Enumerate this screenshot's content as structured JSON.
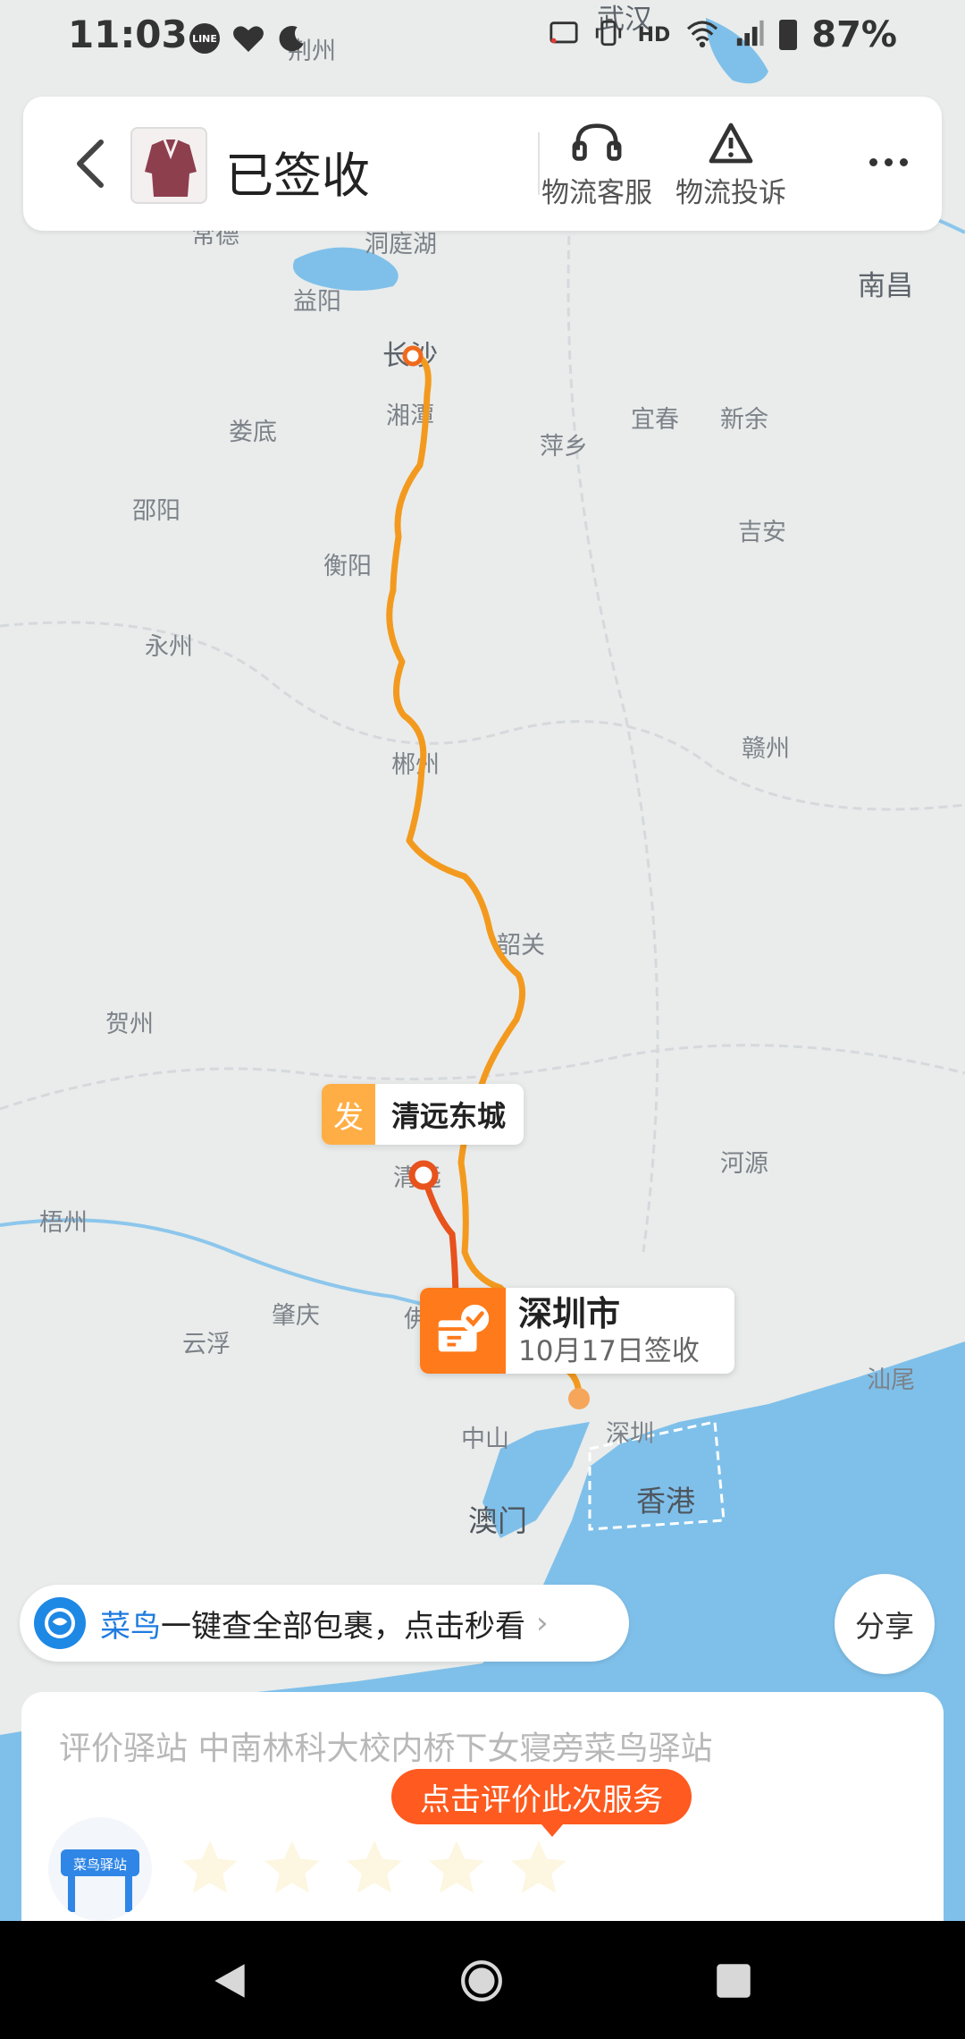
{
  "status_bar": {
    "time": "11:03",
    "battery": "87%",
    "icons": [
      "line-icon",
      "heart-icon",
      "moon-icon",
      "cast-icon",
      "vibrate-icon",
      "hd-icon",
      "wifi-icon",
      "signal-icon",
      "battery-icon"
    ]
  },
  "header": {
    "title": "已签收",
    "customer_service_label": "物流客服",
    "complaint_label": "物流投诉"
  },
  "map": {
    "labels": {
      "wuhan": "武汉",
      "jingzhou": "荆州",
      "dongting": "洞庭湖",
      "changde": "常德",
      "yiyang": "益阳",
      "changsha": "长沙",
      "xiangtan": "湘潭",
      "loudi": "娄底",
      "pingxiang": "萍乡",
      "yichun": "宜春",
      "xinyu": "新余",
      "nanchang": "南昌",
      "shaoyang": "邵阳",
      "hengyang": "衡阳",
      "jian": "吉安",
      "yongzhou": "永州",
      "chenzhou": "郴州",
      "ganzhou": "赣州",
      "shaoguan": "韶关",
      "hezhou": "贺州",
      "qingyuan": "清远",
      "heyuan": "河源",
      "wuzhou": "梧州",
      "zhaoqing": "肇庆",
      "yunfu": "云浮",
      "foshan": "佛",
      "zhongshan": "中山",
      "shenzhen": "深圳",
      "shanwei": "汕尾",
      "macau": "澳门",
      "hongkong": "香港"
    },
    "origin_badge": "发",
    "origin_name": "清远东城",
    "destination_city": "深圳市",
    "destination_status": "10月17日签收"
  },
  "banner": {
    "brand": "菜鸟",
    "text": "一键查全部包裹，点击秒看"
  },
  "share_label": "分享",
  "review": {
    "station_line": "评价驿站 中南林科大校内桥下女寝旁菜鸟驿站",
    "tip": "点击评价此次服务",
    "station_logo_text": "菜鸟驿站",
    "rating": 0,
    "max_rating": 5
  },
  "colors": {
    "route": "#f39a1e",
    "route_dark": "#e8521c",
    "accent_orange": "#ff7a1a",
    "send_badge": "#ffae45",
    "cainiao_blue": "#1e7be0",
    "sea": "#7fc0ea",
    "land": "#e9eceb"
  }
}
